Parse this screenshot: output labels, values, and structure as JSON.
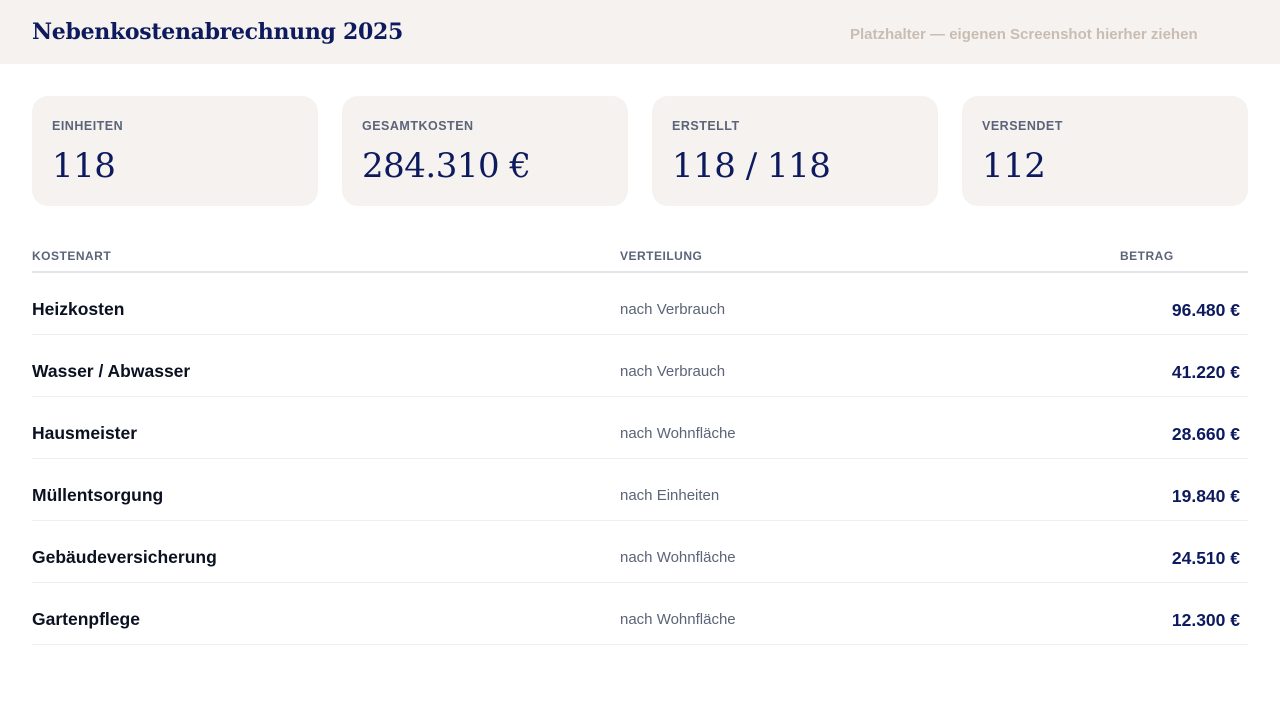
{
  "header": {
    "title": "Nebenkostenabrechnung 2025",
    "placeholder": "Platzhalter — eigenen Screenshot hierher ziehen"
  },
  "stats": [
    {
      "label": "EINHEITEN",
      "value": "118"
    },
    {
      "label": "GESAMTKOSTEN",
      "value": "284.310 €"
    },
    {
      "label": "ERSTELLT",
      "value": "118 / 118"
    },
    {
      "label": "VERSENDET",
      "value": "112"
    }
  ],
  "table": {
    "columns": {
      "kostenart": "KOSTENART",
      "verteilung": "VERTEILUNG",
      "betrag": "BETRAG"
    },
    "rows": [
      {
        "name": "Heizkosten",
        "method": "nach Verbrauch",
        "amount": "96.480 €"
      },
      {
        "name": "Wasser / Abwasser",
        "method": "nach Verbrauch",
        "amount": "41.220 €"
      },
      {
        "name": "Hausmeister",
        "method": "nach Wohnfläche",
        "amount": "28.660 €"
      },
      {
        "name": "Müllentsorgung",
        "method": "nach Einheiten",
        "amount": "19.840 €"
      },
      {
        "name": "Gebäudeversicherung",
        "method": "nach Wohnfläche",
        "amount": "24.510 €"
      },
      {
        "name": "Gartenpflege",
        "method": "nach Wohnfläche",
        "amount": "12.300 €"
      }
    ]
  },
  "colors": {
    "accent": "#0d1b5e",
    "surface": "#f6f2ef",
    "muted": "#5b6478"
  }
}
